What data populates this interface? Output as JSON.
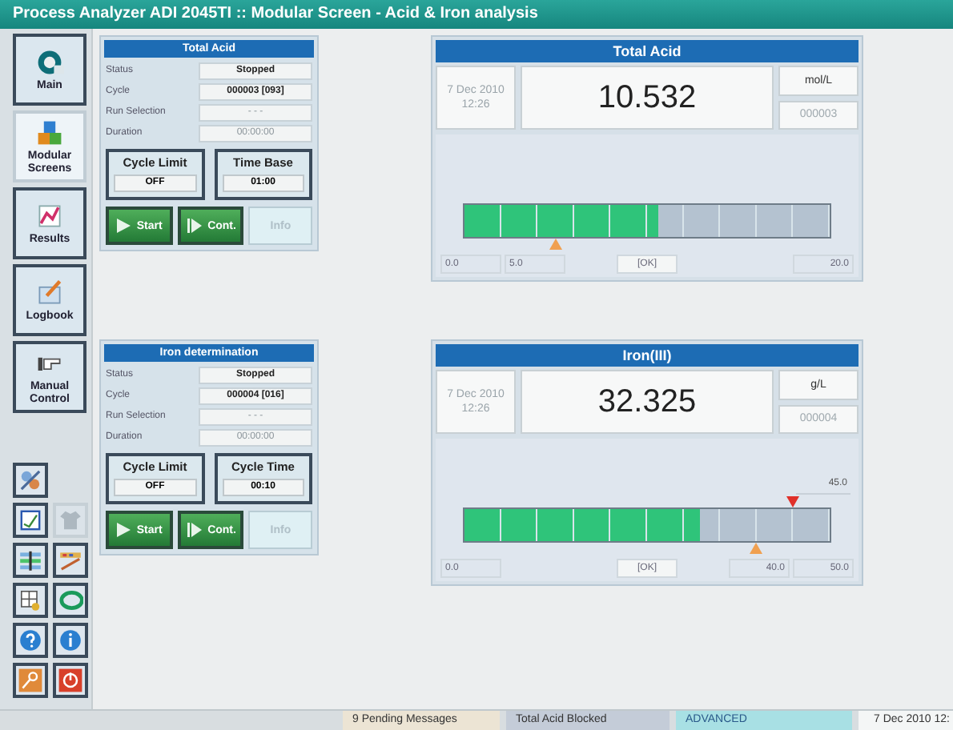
{
  "window": {
    "title": "Process Analyzer ADI 2045TI :: Modular Screen - Acid & Iron analysis"
  },
  "nav": [
    {
      "kind": "main",
      "label": "Main",
      "selected": false
    },
    {
      "kind": "modules",
      "label": "Modular Screens",
      "selected": true
    },
    {
      "kind": "results",
      "label": "Results",
      "selected": false
    },
    {
      "kind": "logbook",
      "label": "Logbook",
      "selected": false
    },
    {
      "kind": "manual",
      "label": "Manual Control",
      "selected": false
    }
  ],
  "tool_rows": [
    [
      {
        "kind": "tools",
        "disabled": false
      }
    ],
    [
      {
        "kind": "board",
        "disabled": false
      },
      {
        "kind": "shirt",
        "disabled": true
      }
    ],
    [
      {
        "kind": "sliders",
        "disabled": false
      },
      {
        "kind": "ruler",
        "disabled": false
      }
    ],
    [
      {
        "kind": "grid",
        "disabled": false
      },
      {
        "kind": "arc",
        "disabled": false
      }
    ],
    [
      {
        "kind": "help",
        "disabled": false
      },
      {
        "kind": "info",
        "disabled": false
      }
    ],
    [
      {
        "kind": "key",
        "disabled": false
      },
      {
        "kind": "power",
        "disabled": false
      }
    ]
  ],
  "modules": [
    {
      "title": "Total Acid",
      "fields": [
        {
          "label": "Status",
          "value": "Stopped",
          "bold": true
        },
        {
          "label": "Cycle",
          "value": "000003 [093]",
          "bold": true
        },
        {
          "label": "Run Selection",
          "value": "- - -",
          "bold": false
        },
        {
          "label": "Duration",
          "value": "00:00:00",
          "bold": false
        }
      ],
      "settings": [
        {
          "label": "Cycle Limit",
          "value": "OFF"
        },
        {
          "label": "Time Base",
          "value": "01:00"
        }
      ],
      "buttons": [
        {
          "kind": "start",
          "label": "Start",
          "disabled": false
        },
        {
          "kind": "cont",
          "label": "Cont.",
          "disabled": false
        },
        {
          "kind": "plain",
          "label": "Info",
          "disabled": true
        }
      ],
      "result": {
        "title": "Total Acid",
        "date": "7 Dec 2010",
        "time": "12:26",
        "value": "10.532",
        "unit": "mol/L",
        "counter": "000003",
        "level": 0.53,
        "markers": [
          {
            "kind": "low",
            "level": 0.25
          }
        ],
        "scale": [
          {
            "kind": "min",
            "text": "0.0"
          },
          {
            "kind": "low",
            "text": "5.0"
          },
          {
            "kind": "status",
            "text": "[OK]"
          },
          {
            "kind": "max",
            "text": "20.0"
          }
        ]
      }
    },
    {
      "title": "Iron determination",
      "fields": [
        {
          "label": "Status",
          "value": "Stopped",
          "bold": true
        },
        {
          "label": "Cycle",
          "value": "000004 [016]",
          "bold": true
        },
        {
          "label": "Run Selection",
          "value": "- - -",
          "bold": false
        },
        {
          "label": "Duration",
          "value": "00:00:00",
          "bold": false
        }
      ],
      "settings": [
        {
          "label": "Cycle Limit",
          "value": "OFF"
        },
        {
          "label": "Cycle Time",
          "value": "00:10"
        }
      ],
      "buttons": [
        {
          "kind": "start",
          "label": "Start",
          "disabled": false
        },
        {
          "kind": "cont",
          "label": "Cont.",
          "disabled": false
        },
        {
          "kind": "plain",
          "label": "Info",
          "disabled": true
        }
      ],
      "result": {
        "title": "Iron(III)",
        "date": "7 Dec 2010",
        "time": "12:26",
        "value": "32.325",
        "unit": "g/L",
        "counter": "000004",
        "level": 0.645,
        "markers": [
          {
            "kind": "high",
            "level": 0.9
          },
          {
            "kind": "low",
            "level": 0.8
          }
        ],
        "scale": [
          {
            "kind": "limit",
            "text": "45.0"
          },
          {
            "kind": "min",
            "text": "0.0"
          },
          {
            "kind": "status",
            "text": "[OK]"
          },
          {
            "kind": "high",
            "text": "40.0"
          },
          {
            "kind": "max",
            "text": "50.0"
          }
        ]
      }
    }
  ],
  "status_bar": [
    {
      "kind": "blank"
    },
    {
      "kind": "messages",
      "text": "9 Pending Messages"
    },
    {
      "kind": "blocked",
      "text": "Total Acid Blocked"
    },
    {
      "kind": "mode",
      "text": "ADVANCED"
    },
    {
      "kind": "clock",
      "text": "7 Dec 2010 12:"
    }
  ]
}
